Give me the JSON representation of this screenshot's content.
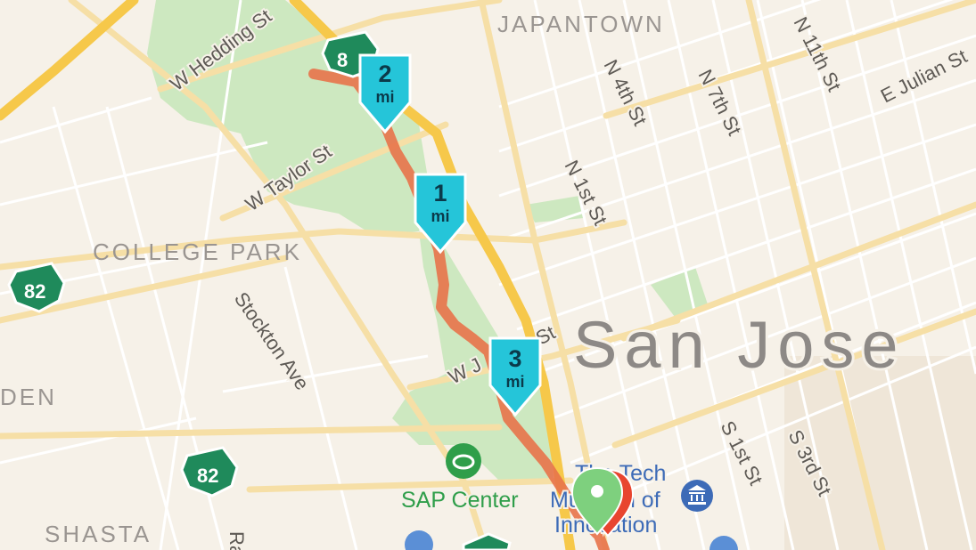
{
  "map": {
    "city_label": "San Jose",
    "districts": [
      {
        "id": "japantown",
        "label": "JAPANTOWN"
      },
      {
        "id": "college-park",
        "label": "COLLEGE PARK"
      },
      {
        "id": "shasta",
        "label": "SHASTA"
      },
      {
        "id": "den",
        "label": "DEN"
      }
    ],
    "streets": [
      {
        "id": "w-hedding",
        "label": "W Hedding St"
      },
      {
        "id": "w-taylor",
        "label": "W Taylor St"
      },
      {
        "id": "stockton",
        "label": "Stockton Ave"
      },
      {
        "id": "n-4th",
        "label": "N 4th St"
      },
      {
        "id": "n-7th",
        "label": "N 7th St"
      },
      {
        "id": "n-11th",
        "label": "N 11th St"
      },
      {
        "id": "e-julian",
        "label": "E Julian St"
      },
      {
        "id": "n-1st",
        "label": "N 1st St"
      },
      {
        "id": "s-1st",
        "label": "S 1st St"
      },
      {
        "id": "s-3rd",
        "label": "S 3rd St"
      },
      {
        "id": "w-julian",
        "label": "W J"
      },
      {
        "id": "w-julian-end",
        "label": "St"
      },
      {
        "id": "ra",
        "label": "Ra"
      }
    ],
    "highway_shields": [
      {
        "id": "hwy-82-a",
        "label": "82"
      },
      {
        "id": "hwy-82-b",
        "label": "82"
      },
      {
        "id": "hwy-87-top",
        "label": "8"
      }
    ],
    "pois": [
      {
        "id": "sap-center",
        "label": "SAP Center",
        "icon": "stadium-icon",
        "color": "#2f9e4a"
      },
      {
        "id": "tech-museum",
        "label_lines": [
          "The Tech",
          "Museum of",
          "Innovation"
        ],
        "icon": "museum-icon",
        "color": "#3d6bb7"
      }
    ],
    "route": {
      "color": "#e8734a",
      "mile_markers": [
        {
          "mile": "1",
          "unit": "mi"
        },
        {
          "mile": "2",
          "unit": "mi"
        },
        {
          "mile": "3",
          "unit": "mi"
        }
      ],
      "start_pin_color": "#7ed07e",
      "end_pin_color": "#e8452f"
    },
    "colors": {
      "land": "#f6f1e8",
      "park": "#cde8c0",
      "highway": "#f6c84a",
      "road": "#f6dfa6",
      "marker": "#25c5d9"
    }
  }
}
